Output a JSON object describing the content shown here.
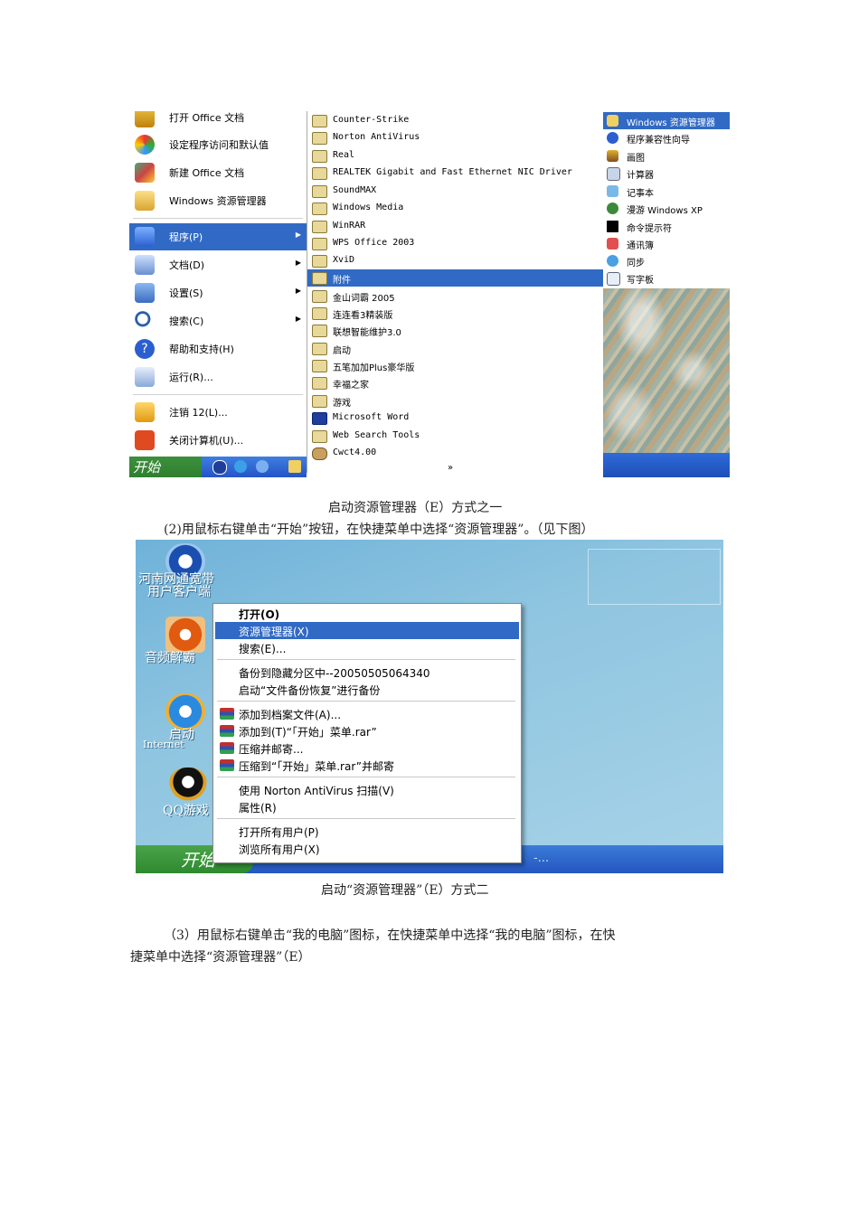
{
  "screenshot1": {
    "left_items": [
      {
        "label": "打开 Office 文档"
      },
      {
        "label": "设定程序访问和默认值"
      },
      {
        "label": "新建 Office 文档"
      },
      {
        "label": "Windows 资源管理器"
      },
      {
        "label": "程序(P)"
      },
      {
        "label": "文档(D)"
      },
      {
        "label": "设置(S)"
      },
      {
        "label": "搜索(C)"
      },
      {
        "label": "帮助和支持(H)"
      },
      {
        "label": "运行(R)..."
      },
      {
        "label": "注销 12(L)..."
      },
      {
        "label": "关闭计算机(U)..."
      }
    ],
    "programs": [
      "Counter-Strike",
      "Norton AntiVirus",
      "Real",
      "REALTEK Gigabit and Fast Ethernet NIC Driver",
      "SoundMAX",
      "Windows Media",
      "WinRAR",
      "WPS Office 2003",
      "XviD",
      "附件",
      "金山词霸 2005",
      "连连看3精装版",
      "联想智能维护3.0",
      "启动",
      "五笔加加Plus豪华版",
      "幸福之家",
      "游戏",
      "Microsoft Word",
      "Web Search Tools",
      "Cwct4.00"
    ],
    "accessories": [
      "Windows 资源管理器",
      "程序兼容性向导",
      "画图",
      "计算器",
      "记事本",
      "漫游 Windows XP",
      "命令提示符",
      "通讯簿",
      "同步",
      "写字板"
    ],
    "start_label": "开始",
    "more_glyph": "»",
    "colors": {
      "highlight": "#316ac5",
      "taskbar_green": "#2f7f2f",
      "taskbar_blue": "#2454c8"
    }
  },
  "caption1": "启动资源管理器（E）方式之一",
  "para2": "(2)用鼠标右键单击“开始”按钮，在快捷菜单中选择“资源管理器”。（见下图）",
  "screenshot2": {
    "desktop_icons": [
      {
        "label_line1": "河南网通宽带",
        "label_line2": "用户客户端"
      },
      {
        "label_line1": "音频解霸",
        "label_line2": ""
      },
      {
        "label_line1": "启动",
        "label_line2": "Internet"
      },
      {
        "label_line1": "QQ游戏",
        "label_line2": ""
      }
    ],
    "context_menu": [
      "打开(O)",
      "资源管理器(X)",
      "搜索(E)...",
      "备份到隐藏分区中--20050505064340",
      "启动“文件备份恢复”进行备份",
      "添加到档案文件(A)...",
      "添加到(T)“「开始」菜单.rar”",
      "压缩并邮寄...",
      "压缩到“「开始」菜单.rar”并邮寄",
      "使用 Norton AntiVirus 扫描(V)",
      "属性(R)",
      "打开所有用户(P)",
      "浏览所有用户(X)"
    ],
    "start_label": "开始",
    "taskbar_text": "-...",
    "colors": {
      "desktop": "#8fc5e0",
      "highlight": "#316ac5"
    }
  },
  "caption2": "启动“资源管理器”（E）方式二",
  "para3_line1": "（3）用鼠标右键单击“我的电脑”图标，在快捷菜单中选择“我的电脑”图标，在快",
  "para3_line2": "捷菜单中选择“资源管理器”（E）"
}
